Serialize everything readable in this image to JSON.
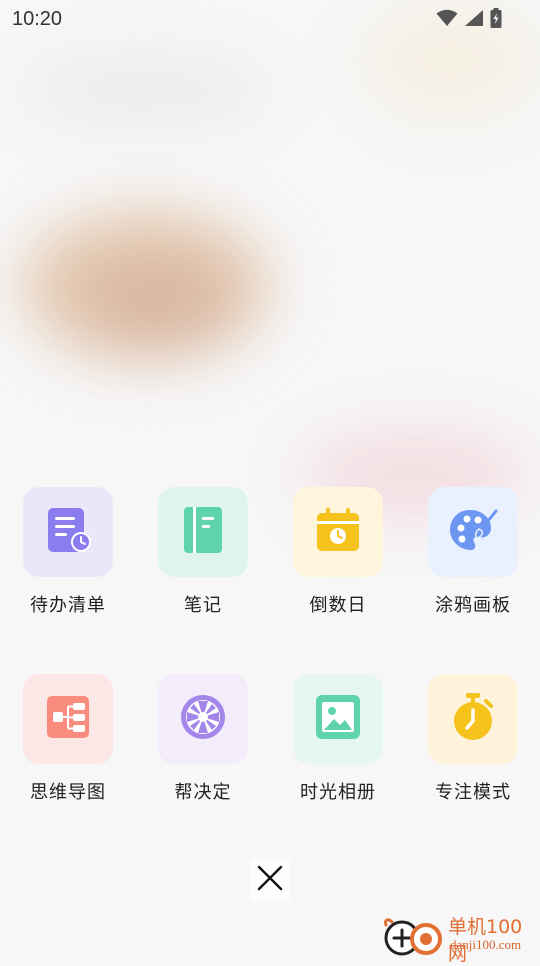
{
  "status_bar": {
    "time": "10:20",
    "icons": [
      "wifi-icon",
      "cellular-signal-icon",
      "battery-charging-icon"
    ]
  },
  "apps": [
    {
      "label": "待办清单",
      "icon": "todo-list-icon",
      "tile_bg": "#ece6fb",
      "icon_color": "#8b7cf0"
    },
    {
      "label": "笔记",
      "icon": "notebook-icon",
      "tile_bg": "#dff5ec",
      "icon_color": "#5fd3ab"
    },
    {
      "label": "倒数日",
      "icon": "calendar-clock-icon",
      "tile_bg": "#fff5dc",
      "icon_color": "#f6c21c"
    },
    {
      "label": "涂鸦画板",
      "icon": "paint-palette-icon",
      "tile_bg": "#e9f0fe",
      "icon_color": "#6c96f2"
    },
    {
      "label": "思维导图",
      "icon": "mind-map-icon",
      "tile_bg": "#fde7e6",
      "icon_color": "#f98c7f"
    },
    {
      "label": "帮决定",
      "icon": "decision-wheel-icon",
      "tile_bg": "#f2ecfb",
      "icon_color": "#a486ea"
    },
    {
      "label": "时光相册",
      "icon": "photo-album-icon",
      "tile_bg": "#e6f7ef",
      "icon_color": "#5fd3ab"
    },
    {
      "label": "专注模式",
      "icon": "stopwatch-icon",
      "tile_bg": "#fff3dc",
      "icon_color": "#f6c21c"
    }
  ],
  "close": {
    "icon": "close-icon"
  },
  "watermark": {
    "title": "单机100网",
    "url": "danji100.com"
  }
}
